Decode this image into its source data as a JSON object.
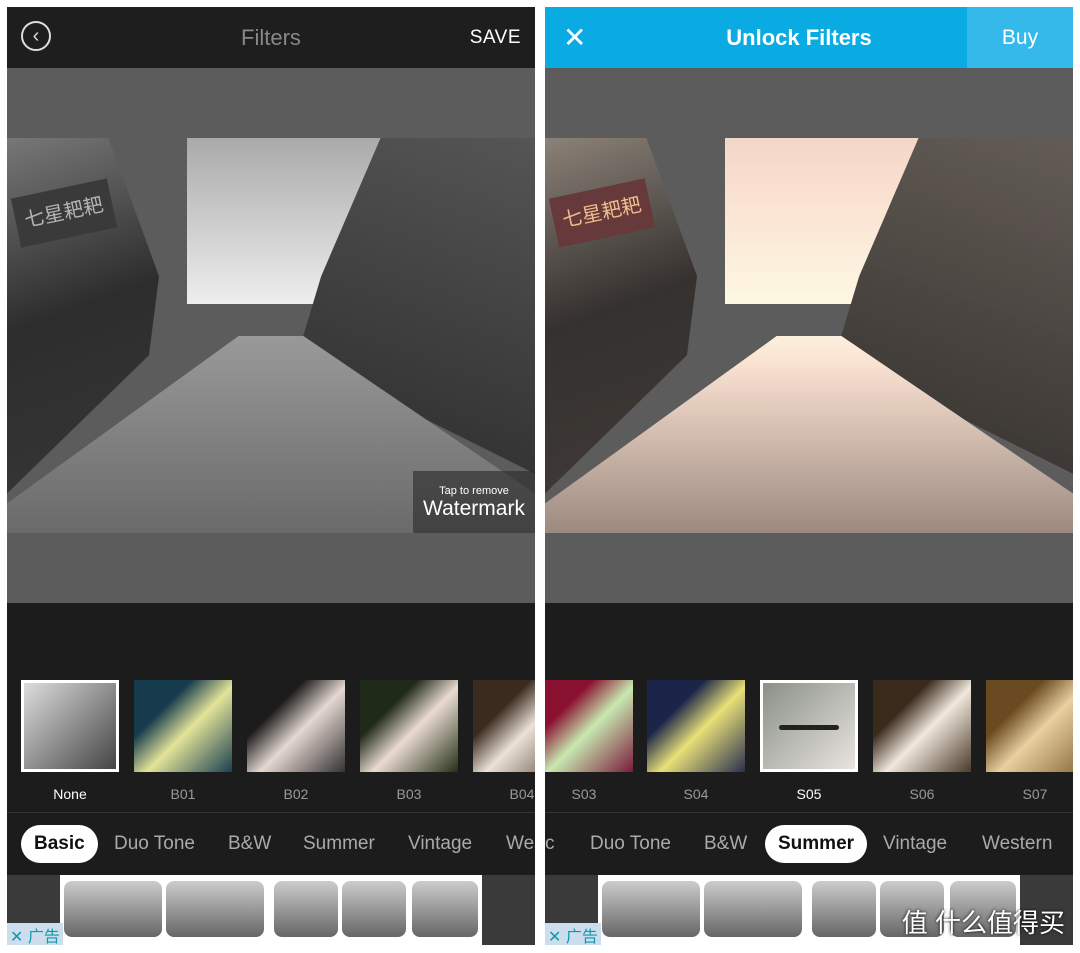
{
  "left": {
    "title": "Filters",
    "save_label": "SAVE",
    "watermark_small": "Tap to remove",
    "watermark_large": "Watermark",
    "sign_text": "七星耙耙",
    "filters": [
      {
        "label": "None",
        "selected": true
      },
      {
        "label": "B01"
      },
      {
        "label": "B02"
      },
      {
        "label": "B03"
      },
      {
        "label": "B04"
      }
    ],
    "tabs": [
      {
        "label": "Basic",
        "selected": true
      },
      {
        "label": "Duo Tone"
      },
      {
        "label": "B&W"
      },
      {
        "label": "Summer"
      },
      {
        "label": "Vintage"
      },
      {
        "label": "Wes"
      }
    ],
    "ad_label": "广告"
  },
  "right": {
    "title": "Unlock Filters",
    "buy_label": "Buy",
    "sign_text": "七星耙耙",
    "filters": [
      {
        "label": "S03"
      },
      {
        "label": "S04"
      },
      {
        "label": "S05",
        "selected": true
      },
      {
        "label": "S06"
      },
      {
        "label": "S07"
      }
    ],
    "tabs": [
      {
        "label": "c"
      },
      {
        "label": "Duo Tone"
      },
      {
        "label": "B&W"
      },
      {
        "label": "Summer",
        "selected": true
      },
      {
        "label": "Vintage"
      },
      {
        "label": "Western"
      }
    ],
    "ad_label": "广告",
    "site_watermark": "值 什么值得买"
  },
  "colors": {
    "header_blue": "#0aaae2",
    "buy_blue": "#34b9ea"
  }
}
